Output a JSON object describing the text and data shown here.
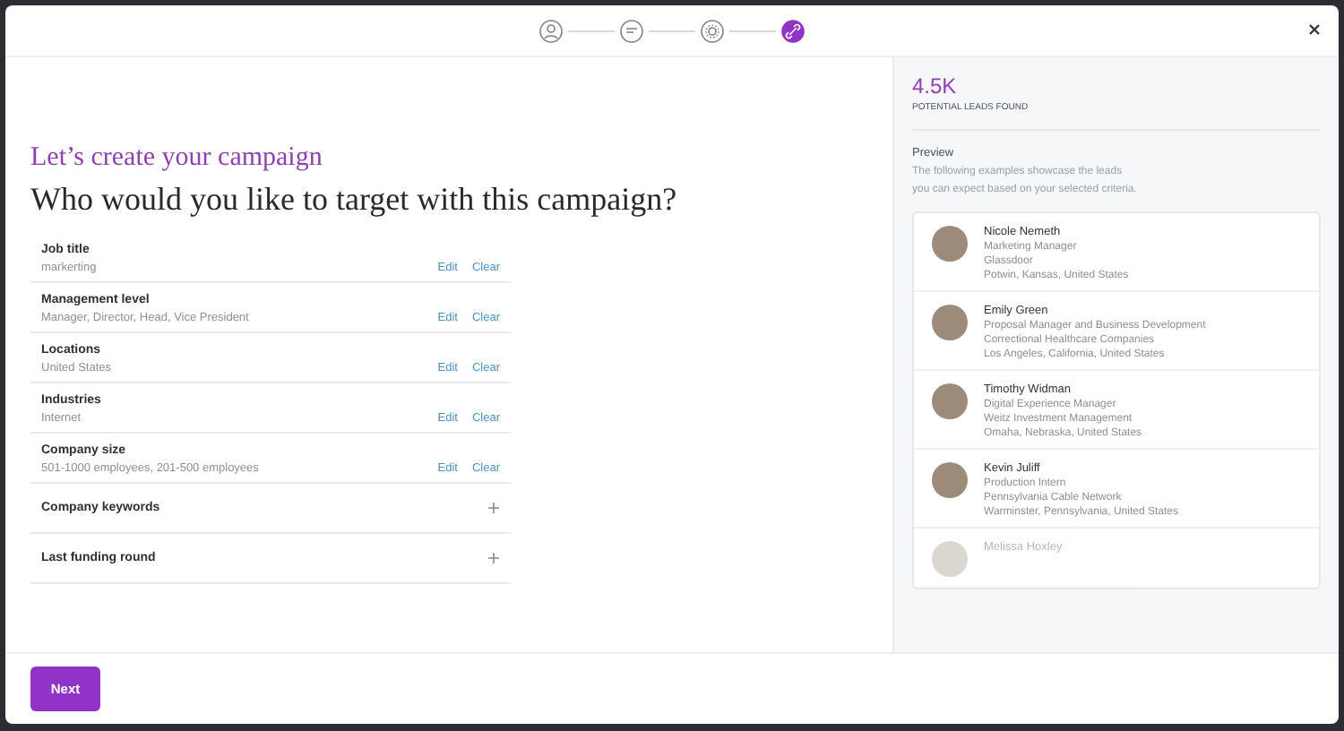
{
  "steps": [
    {
      "kind": "person",
      "selected": false
    },
    {
      "kind": "chat",
      "selected": false
    },
    {
      "kind": "gear",
      "selected": false
    },
    {
      "kind": "link",
      "selected": true
    }
  ],
  "heading": "Let’s create your campaign",
  "question": "Who would you like to target with this campaign?",
  "criteria": [
    {
      "kind": "filled",
      "label": "Job title",
      "value": "markerting",
      "edit": "Edit",
      "clear": "Clear"
    },
    {
      "kind": "filled",
      "label": "Management level",
      "value": "Manager, Director, Head, Vice President",
      "edit": "Edit",
      "clear": "Clear"
    },
    {
      "kind": "filled",
      "label": "Locations",
      "value": "United States",
      "edit": "Edit",
      "clear": "Clear"
    },
    {
      "kind": "filled",
      "label": "Industries",
      "value": "Internet",
      "edit": "Edit",
      "clear": "Clear"
    },
    {
      "kind": "filled",
      "label": "Company size",
      "value": "501-1000 employees, 201-500 employees",
      "edit": "Edit",
      "clear": "Clear"
    },
    {
      "kind": "empty",
      "label": "Company keywords"
    },
    {
      "kind": "empty",
      "label": "Last funding round"
    }
  ],
  "leads_count": "4.5K",
  "leads_caption": "POTENTIAL LEADS FOUND",
  "preview": {
    "title": "Preview",
    "text": "The following examples showcase the leads\nyou can expect based on your selected criteria."
  },
  "leads": [
    {
      "name": "Nicole Nemeth",
      "title": "Marketing Manager",
      "company": "Glassdoor",
      "location": "Potwin, Kansas, United States",
      "faded": false
    },
    {
      "name": "Emily Green",
      "title": "Proposal Manager and Business Development",
      "company": "Correctional Healthcare Companies",
      "location": "Los Angeles, California, United States",
      "faded": false
    },
    {
      "name": "Timothy Widman",
      "title": "Digital Experience Manager",
      "company": "Weitz Investment Management",
      "location": "Omaha, Nebraska, United States",
      "faded": false
    },
    {
      "name": "Kevin Juliff",
      "title": "Production Intern",
      "company": "Pennsylvania Cable Network",
      "location": "Warminster, Pennsylvania, United States",
      "faded": false
    },
    {
      "name": "Melissa Hoxley",
      "faded": true
    }
  ],
  "next_button": "Next"
}
